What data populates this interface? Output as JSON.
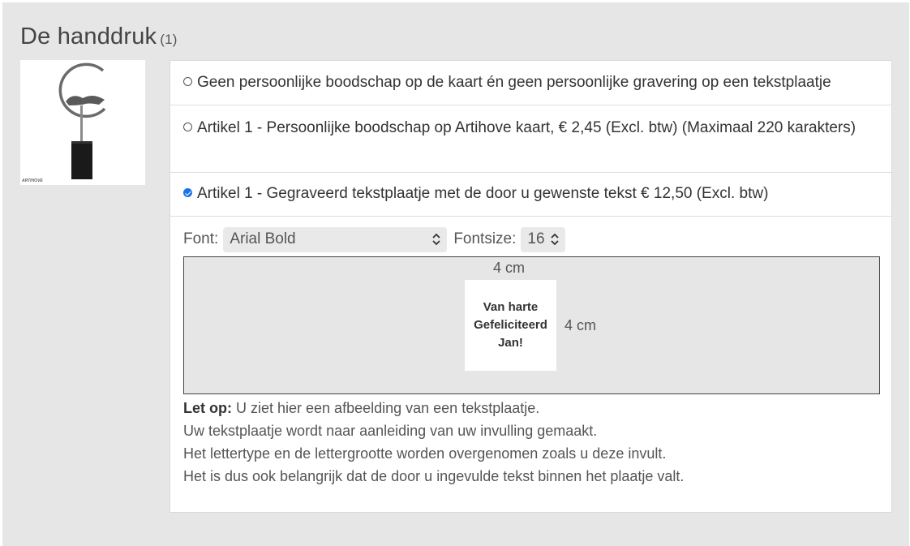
{
  "header": {
    "title": "De handdruk",
    "count": "(1)"
  },
  "product": {
    "image": "handshake-sculpture",
    "brand": "ARTIHOVE"
  },
  "options": [
    {
      "label": "Geen persoonlijke boodschap op de kaart én geen persoonlijke gravering op een tekstplaatje",
      "checked": false
    },
    {
      "label": "Artikel 1 - Persoonlijke boodschap op Artihove kaart, € 2,45 (Excl. btw) (Maximaal 220 karakters)",
      "checked": false
    },
    {
      "label": "Artikel 1 - Gegraveerd tekstplaatje met de door u gewenste tekst € 12,50 (Excl. btw)",
      "checked": true
    }
  ],
  "engraving": {
    "font_label": "Font:",
    "font_value": "Arial Bold",
    "fontsize_label": "Fontsize:",
    "fontsize_value": "16",
    "width_label": "4 cm",
    "height_label": "4 cm",
    "plate_lines": [
      "Van harte",
      "Gefeliciteerd",
      "Jan!"
    ]
  },
  "notes": {
    "lead": "Let op:",
    "line1": " U ziet hier een afbeelding van een tekstplaatje.",
    "line2": "Uw tekstplaatje wordt naar aanleiding van uw invulling gemaakt.",
    "line3": "Het lettertype en de lettergrootte worden overgenomen zoals u deze invult.",
    "line4": "Het is dus ook belangrijk dat de door u ingevulde tekst binnen het plaatje valt."
  },
  "colors": {
    "checked": "#1a73e8",
    "panel": "#e6e6e6"
  }
}
